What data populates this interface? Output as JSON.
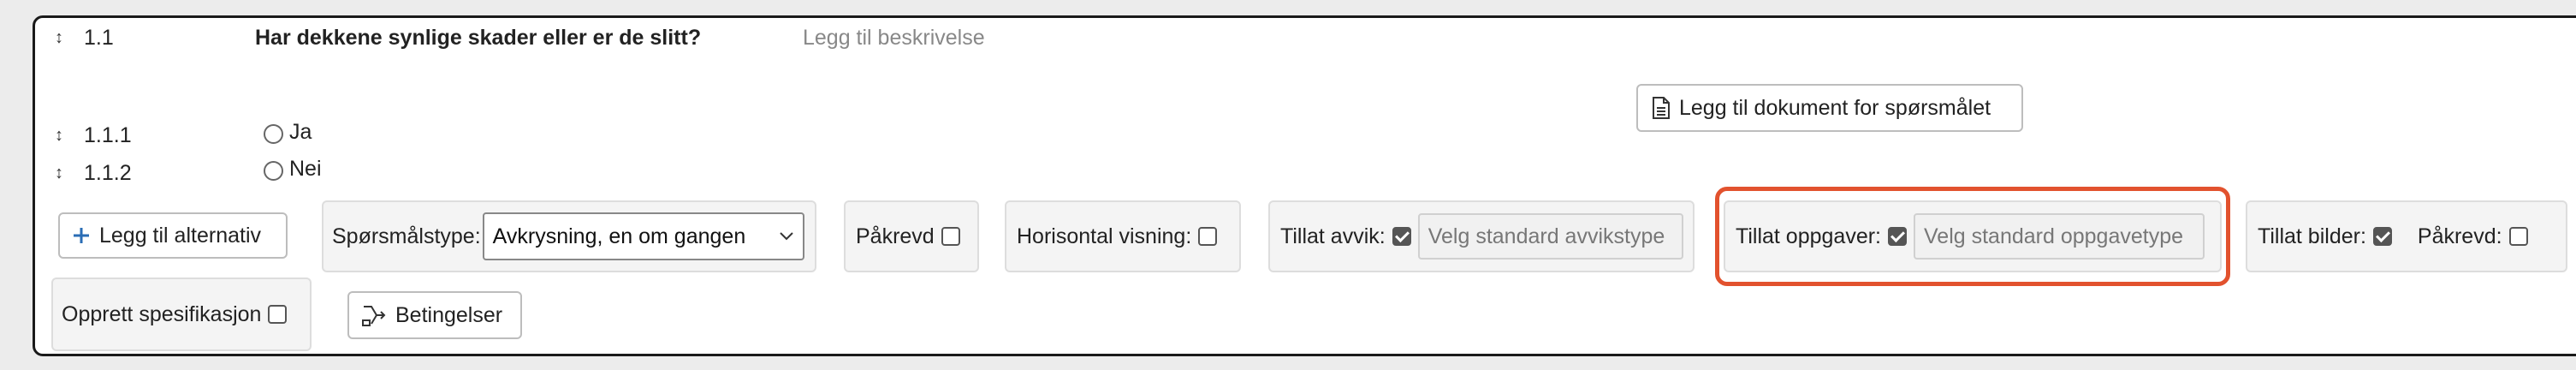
{
  "question": {
    "number": "1.1",
    "title": "Har dekkene synlige skader eller er de slitt",
    "title_suffix": "?",
    "description_placeholder": "Legg til beskrivelse",
    "add_document_label": "Legg til dokument for spørsmålet"
  },
  "options": [
    {
      "number": "1.1.1",
      "label": "Ja"
    },
    {
      "number": "1.1.2",
      "label": "Nei"
    }
  ],
  "toolbar": {
    "add_option_label": "Legg til alternativ",
    "question_type_label": "Spørsmålstype:",
    "question_type_value": "Avkrysning, en om gangen",
    "required_label": "Påkrevd",
    "horizontal_label": "Horisontal visning:",
    "allow_deviation_label": "Tillat avvik:",
    "deviation_type_placeholder": "Velg standard avvikstype",
    "allow_tasks_label": "Tillat oppgaver:",
    "task_type_placeholder": "Velg standard oppgavetype",
    "allow_images_label": "Tillat bilder:",
    "images_required_label": "Påkrevd:",
    "create_specification_label": "Opprett spesifikasjon",
    "conditions_label": "Betingelser"
  },
  "state": {
    "required": false,
    "horizontal": false,
    "allow_deviation": true,
    "allow_tasks": true,
    "allow_images": true,
    "images_required": false,
    "create_specification": false
  },
  "colors": {
    "highlight": "#e2522e",
    "plus_icon": "#2a6db5",
    "card_border": "#1a1a1a"
  },
  "icons": {
    "drag": "drag-handle-icon",
    "document": "document-icon",
    "plus": "plus-icon",
    "conditions": "branch-icon",
    "chevron": "chevron-down-icon"
  }
}
